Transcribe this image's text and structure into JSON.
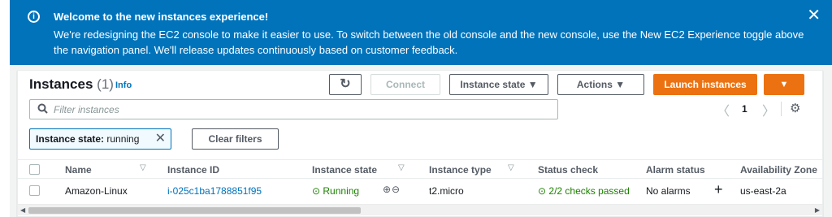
{
  "banner": {
    "title": "Welcome to the new instances experience!",
    "body": "We're redesigning the EC2 console to make it easier to use. To switch between the old console and the new console, use the New EC2 Experience toggle above the navigation panel. We'll release updates continuously based on customer feedback.",
    "close": "✕",
    "info_glyph": "i"
  },
  "panel": {
    "title": "Instances",
    "count": "(1)",
    "info": "Info"
  },
  "toolbar": {
    "refresh": "↻",
    "connect": "Connect",
    "instance_state": "Instance state ▼",
    "actions": "Actions ▼",
    "launch": "Launch instances",
    "launch_dropdown": "▼"
  },
  "filter": {
    "placeholder": "Filter instances",
    "token_key": "Instance state:",
    "token_value": " running",
    "clear": "Clear filters"
  },
  "pagination": {
    "prev": "〈",
    "page": "1",
    "next": "〉",
    "settings": "⚙"
  },
  "table": {
    "headers": [
      "Name",
      "Instance ID",
      "Instance state",
      "Instance type",
      "Status check",
      "Alarm status",
      "Availability Zone"
    ],
    "rows": [
      {
        "name": "Amazon-Linux",
        "instance_id": "i-025c1ba1788851f95",
        "state": "⊙ Running",
        "zoom": "⊕⊖",
        "type": "t2.micro",
        "status_check": "⊙ 2/2 checks passed",
        "alarm": "No alarms",
        "alarm_add": "+",
        "az": "us-east-2a"
      }
    ]
  },
  "colors": {
    "banner": "#0073bb",
    "primary": "#ec7211",
    "link": "#0073bb",
    "success": "#1d8102"
  }
}
